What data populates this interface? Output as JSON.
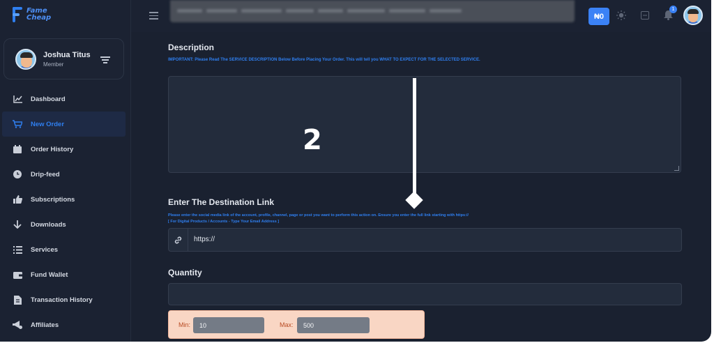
{
  "brand": {
    "logo_line1": "Fame",
    "logo_line2": "Cheap",
    "accent": "#2f7ff0"
  },
  "profile": {
    "name": "Joshua Titus",
    "role": "Member"
  },
  "sidebar": {
    "items": [
      {
        "label": "Dashboard",
        "icon": "chart-icon"
      },
      {
        "label": "New Order",
        "icon": "cart-icon",
        "active": true
      },
      {
        "label": "Order History",
        "icon": "calendar-icon"
      },
      {
        "label": "Drip-feed",
        "icon": "clock-icon"
      },
      {
        "label": "Subscriptions",
        "icon": "thumbs-up-icon"
      },
      {
        "label": "Downloads",
        "icon": "arrow-down-icon"
      },
      {
        "label": "Services",
        "icon": "list-icon"
      },
      {
        "label": "Fund Wallet",
        "icon": "wallet-icon"
      },
      {
        "label": "Transaction History",
        "icon": "receipt-icon"
      },
      {
        "label": "Affiliates",
        "icon": "megaphone-icon"
      }
    ]
  },
  "topbar": {
    "wallet_balance": "₦0",
    "notification_count": "1"
  },
  "form": {
    "description_title": "Description",
    "description_note": "IMPORTANT: Please Read The SERVICE DESCRIPTION Below Before Placing Your Order. This will tell you WHAT TO EXPECT FOR THE SELECTED SERVICE.",
    "description_value": "",
    "link_title": "Enter The Destination Link",
    "link_note_1": "Please enter the social media link of the account, profile, channel, page or post you want to perform this action on. Ensure you enter the full link starting with https://",
    "link_note_2": "[ For Digital Products / Accounts - Type Your Email Address ]",
    "link_value": "https://",
    "quantity_title": "Quantity",
    "quantity_value": "",
    "min_label": "Min:",
    "min_value": "10",
    "max_label": "Max:",
    "max_value": "500"
  },
  "annotation": {
    "number": "2"
  }
}
